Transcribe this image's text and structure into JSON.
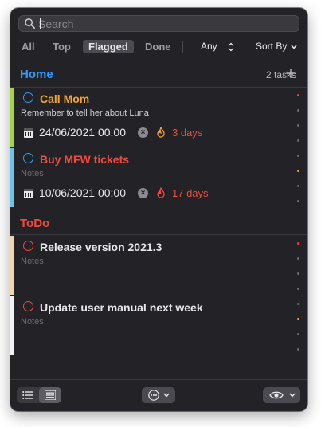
{
  "search": {
    "placeholder": "Search"
  },
  "filters": {
    "all": "All",
    "top": "Top",
    "flagged": "Flagged",
    "done": "Done",
    "any": "Any",
    "sort": "Sort By"
  },
  "sections": [
    {
      "name": "Home",
      "color": "#2f9bff",
      "count": "2 tasks"
    },
    {
      "name": "ToDo",
      "color": "#ef4a3e"
    }
  ],
  "tasks": [
    {
      "title": "Call Mom",
      "title_color": "#f5a623",
      "bar": "#a3d14a",
      "circle": "#2f9bff",
      "notes": "Remember to tell her about Luna",
      "due": "24/06/2021 00:00",
      "days": "3 days"
    },
    {
      "title": "Buy MFW tickets",
      "title_color": "#ef4a3e",
      "bar": "#6cc3ea",
      "circle": "#2f9bff",
      "notes": "Notes",
      "due": "10/06/2021 00:00",
      "days": "17 days"
    },
    {
      "title": "Release version 2021.3",
      "title_color": "#e8e8ea",
      "bar": "#f0d6aa",
      "circle": "#ef4a3e",
      "notes": "Notes"
    },
    {
      "title": "Update user manual next week",
      "title_color": "#e8e8ea",
      "bar": "#f2f2f2",
      "circle": "#ef4a3e",
      "notes": "Notes"
    }
  ],
  "icons": {
    "search": "search-icon",
    "add": "plus-icon",
    "calendar": "calendar-icon",
    "clear": "clear-x-icon",
    "flame": "flame-icon",
    "list": "list-icon",
    "grid": "compact-list-icon",
    "more": "ellipsis-icon",
    "eye": "eye-icon"
  }
}
